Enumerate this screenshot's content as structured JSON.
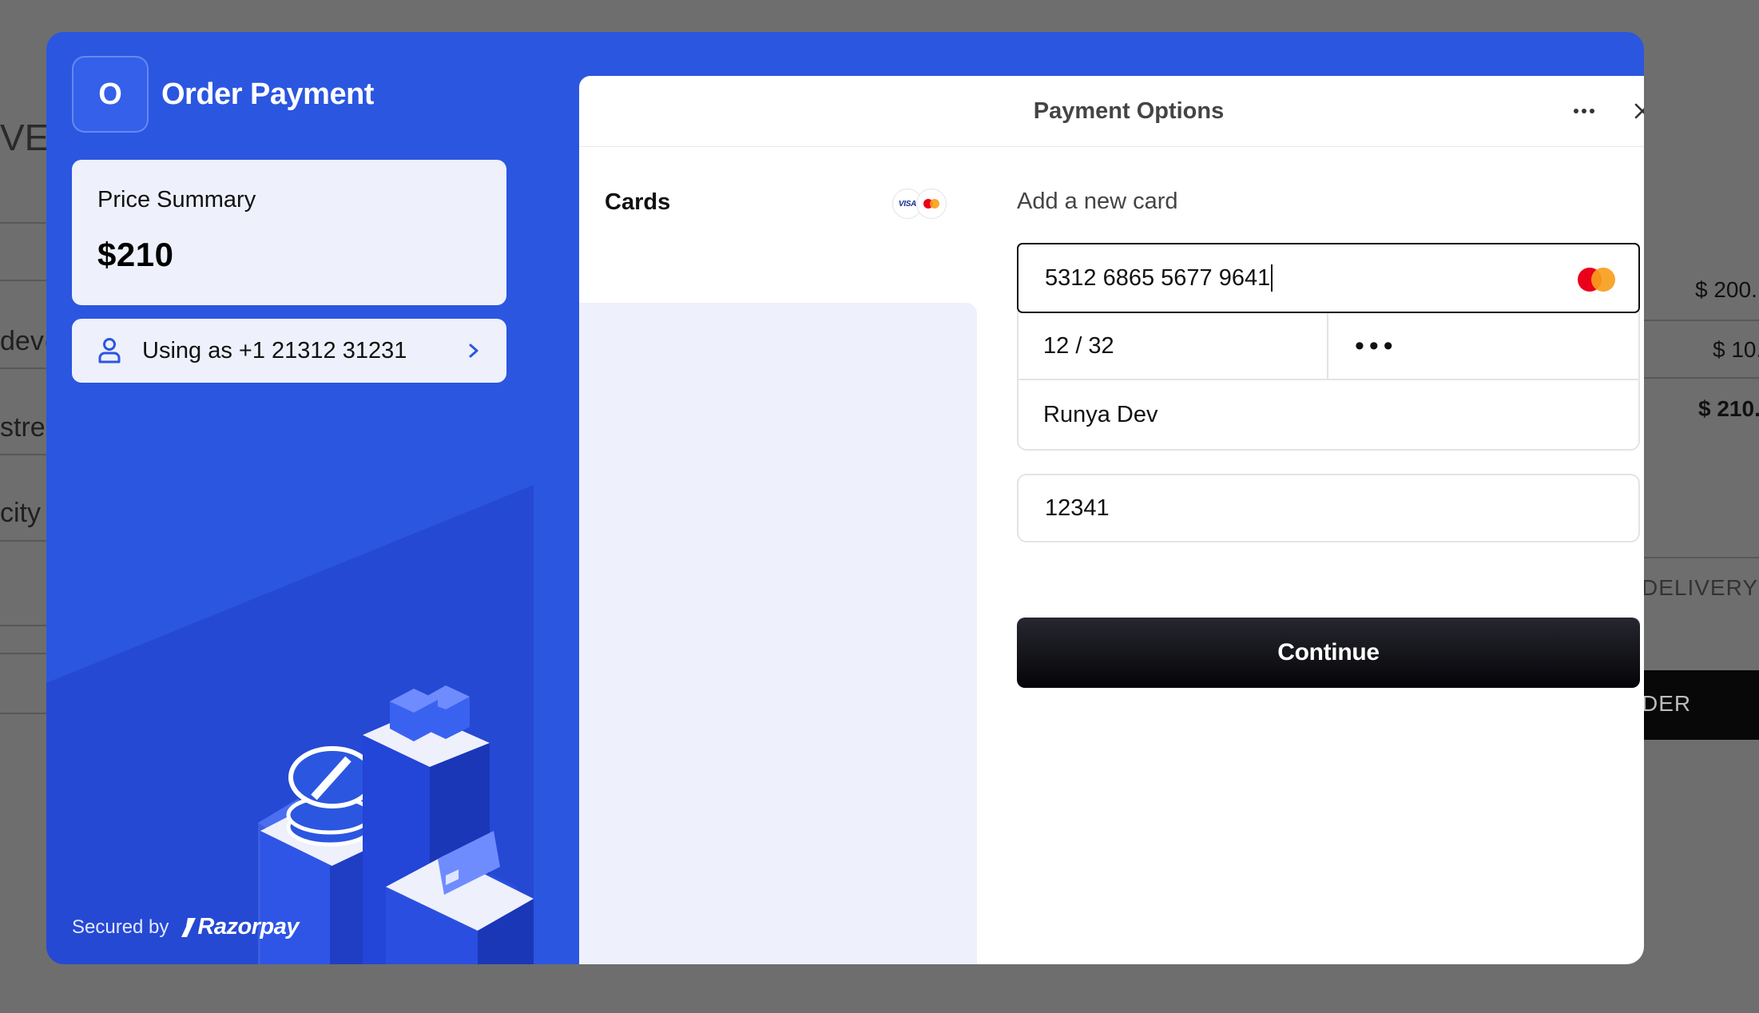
{
  "background": {
    "fragments": [
      "VER",
      "dev@",
      "stree",
      "city",
      "DELIVERY",
      "DER"
    ],
    "amounts": [
      "$ 200.",
      "$ 10.",
      "$ 210."
    ]
  },
  "brand": {
    "initial": "O",
    "name": "Order Payment"
  },
  "price_summary": {
    "label": "Price Summary",
    "value": "$210"
  },
  "user": {
    "text": "Using as +1 21312 31231"
  },
  "secured": {
    "label": "Secured by",
    "provider": "Razorpay"
  },
  "header": {
    "title": "Payment Options"
  },
  "methods": [
    {
      "label": "Cards",
      "badges": [
        "VISA",
        "mastercard"
      ]
    }
  ],
  "form": {
    "heading": "Add a new card",
    "card_number": "5312 6865 5677 9641",
    "expiry": "12 / 32",
    "cvv": "•••",
    "holder": "Runya Dev",
    "extra": "12341",
    "continue_label": "Continue"
  },
  "colors": {
    "modal_blue": "#2b56e0",
    "light_panel": "#eef0fb",
    "button_dark": "#0b0b10",
    "mastercard_red": "#eb001b",
    "mastercard_orange": "#f79e1b"
  }
}
